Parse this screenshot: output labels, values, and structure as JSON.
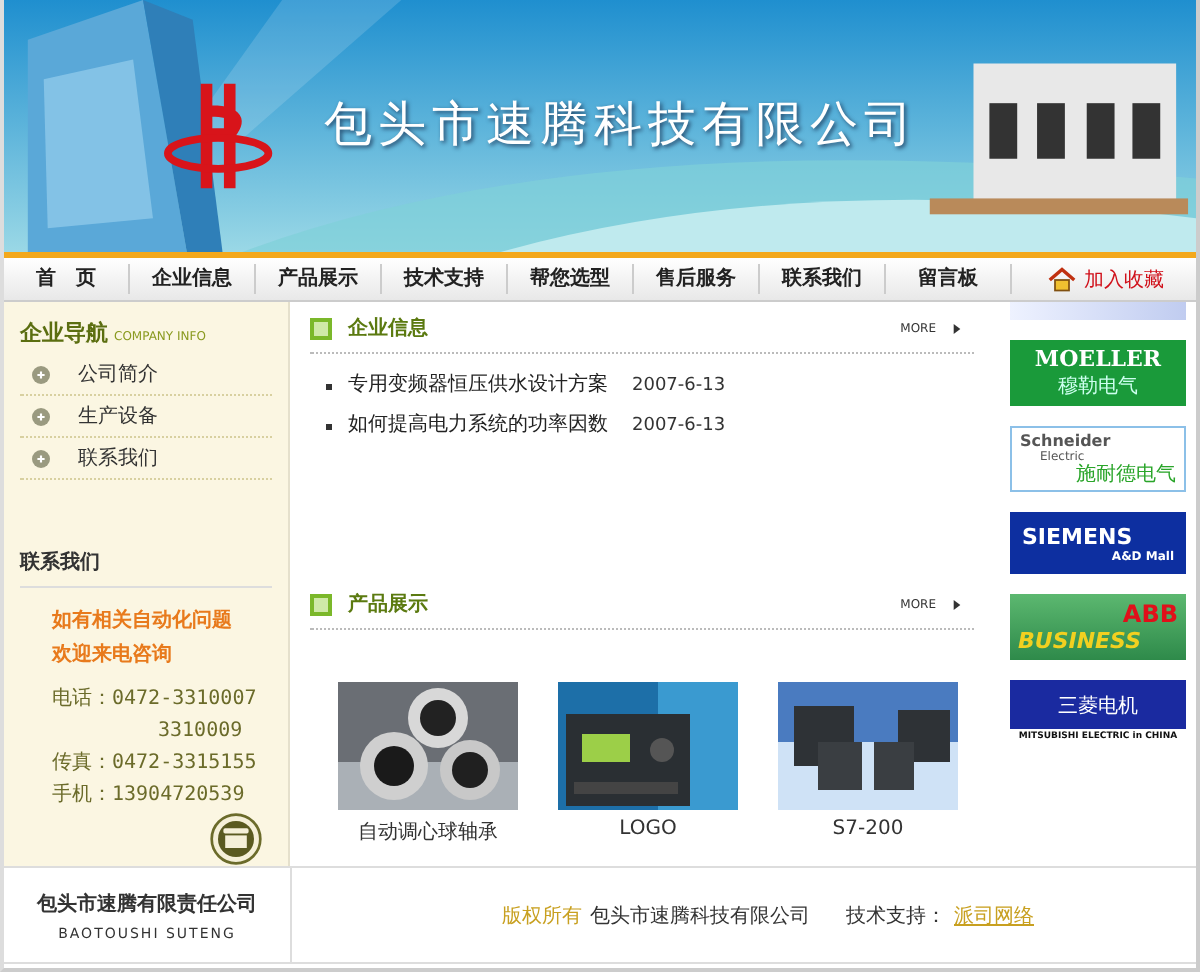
{
  "header": {
    "title": "包头市速腾科技有限公司"
  },
  "nav": {
    "items": [
      {
        "label": "首　页",
        "selected": false
      },
      {
        "label": "企业信息",
        "selected": false
      },
      {
        "label": "产品展示",
        "selected": false
      },
      {
        "label": "技术支持",
        "selected": false
      },
      {
        "label": "帮您选型",
        "selected": false
      },
      {
        "label": "售后服务",
        "selected": false
      },
      {
        "label": "联系我们",
        "selected": false
      },
      {
        "label": "留言板",
        "selected": false
      }
    ],
    "favorite": "加入收藏"
  },
  "sidebar": {
    "title": "企业导航",
    "subtitle": "COMPANY INFO",
    "items": [
      "公司简介",
      "生产设备",
      "联系我们"
    ]
  },
  "contact": {
    "title": "联系我们",
    "slogan": [
      "如有相关自动化问题",
      "欢迎来电咨询"
    ],
    "lines": [
      {
        "kind": "main",
        "text": "电话：0472-3310007"
      },
      {
        "kind": "continued",
        "text": "3310009"
      },
      {
        "kind": "main",
        "text": "传真：0472-3315155"
      },
      {
        "kind": "main",
        "text": "手机：13904720539"
      }
    ]
  },
  "news": {
    "title": "企业信息",
    "more": "MORE",
    "items": [
      {
        "title": "专用变频器恒压供水设计方案",
        "date": "2007-6-13"
      },
      {
        "title": "如何提高电力系统的功率因数",
        "date": "2007-6-13"
      }
    ]
  },
  "products": {
    "title": "产品展示",
    "more": "MORE",
    "items": [
      {
        "name": "自动调心球轴承"
      },
      {
        "name": "LOGO"
      },
      {
        "name": "S7-200"
      }
    ]
  },
  "brands": [
    {
      "kind": "partial"
    },
    {
      "kind": "moeller",
      "lines": [
        "MOELLER",
        "穆勒电气"
      ]
    },
    {
      "kind": "schneider",
      "lines": [
        "Schneider",
        "Electric",
        "施耐德电气"
      ]
    },
    {
      "kind": "siemens",
      "lines": [
        "SIEMENS",
        "A&D Mall"
      ]
    },
    {
      "kind": "abb",
      "lines": [
        "ABB",
        "BUSINESS"
      ]
    },
    {
      "kind": "mitsubishi",
      "lines": [
        "三菱电机",
        "MITSUBISHI ELECTRIC in CHINA"
      ]
    }
  ],
  "footer": {
    "company": "包头市速腾有限责任公司",
    "company_en": "BAOTOUSHI SUTENG",
    "copyright_label": "版权所有",
    "copyright_owner": "包头市速腾科技有限公司",
    "support_label": "技术支持：",
    "support_link": "派司网络"
  }
}
